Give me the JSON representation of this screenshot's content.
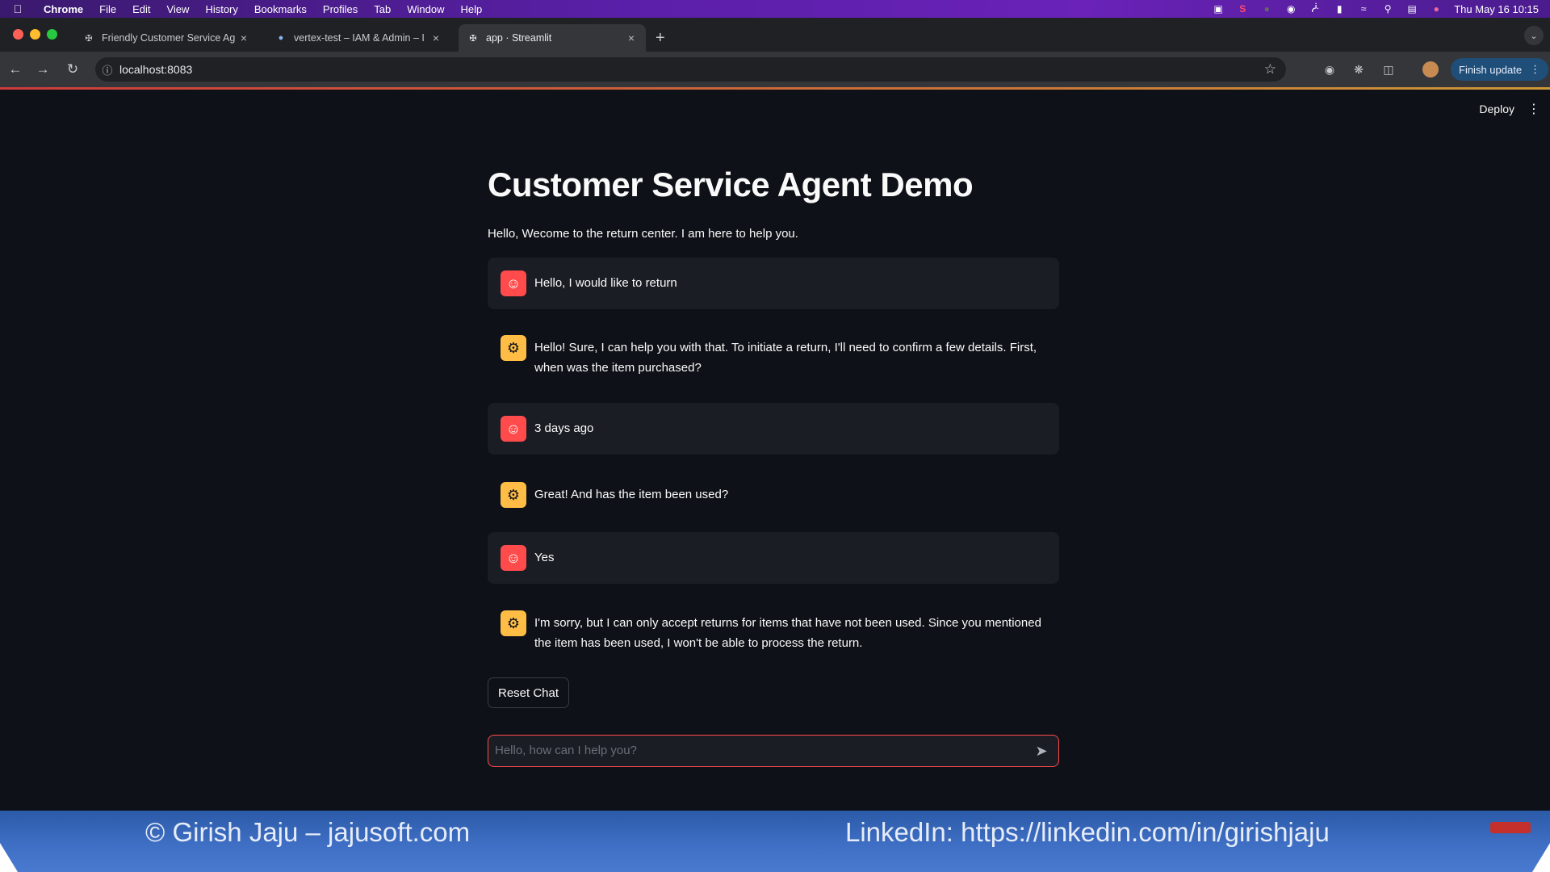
{
  "menubar": {
    "app_name": "Chrome",
    "items": [
      "File",
      "Edit",
      "View",
      "History",
      "Bookmarks",
      "Profiles",
      "Tab",
      "Window",
      "Help"
    ],
    "clock": "Thu May 16  10:15",
    "tray_icons": [
      "docker-icon",
      "s-app-icon",
      "record-icon",
      "bluetooth-icon",
      "battery-icon",
      "wifi-icon",
      "search-icon",
      "control-center-icon",
      "siri-icon"
    ]
  },
  "browser": {
    "tabs": [
      {
        "title": "Friendly Customer Service Ag",
        "icon": "streamlit-icon",
        "active": false
      },
      {
        "title": "vertex-test – IAM & Admin – I",
        "icon": "google-cloud-icon",
        "active": false
      },
      {
        "title": "app · Streamlit",
        "icon": "streamlit-icon",
        "active": true
      }
    ],
    "url": "localhost:8083",
    "finish_update_label": "Finish update"
  },
  "app": {
    "deploy_label": "Deploy",
    "title": "Customer Service Agent Demo",
    "intro": "Hello, Wecome to the return center. I am here to help you.",
    "messages": [
      {
        "role": "user",
        "text": "Hello, I would like to return"
      },
      {
        "role": "assistant",
        "text": "Hello! Sure, I can help you with that. To initiate a return, I'll need to confirm a few details. First, when was the item purchased?"
      },
      {
        "role": "user",
        "text": "3 days ago"
      },
      {
        "role": "assistant",
        "text": "Great! And has the item been used?"
      },
      {
        "role": "user",
        "text": "Yes"
      },
      {
        "role": "assistant",
        "text": "I'm sorry, but I can only accept returns for items that have not been used. Since you mentioned the item has been used, I won't be able to process the return."
      }
    ],
    "reset_label": "Reset Chat",
    "chat_placeholder": "Hello, how can I help you?"
  },
  "banner": {
    "left": "© Girish Jaju – jajusoft.com",
    "right": "LinkedIn: https://linkedin.com/in/girishjaju"
  },
  "colors": {
    "user_avatar": "#ff4b4b",
    "assistant_avatar": "#ffbd45",
    "app_bg": "#0e1117",
    "input_border": "#ff4b4b"
  }
}
